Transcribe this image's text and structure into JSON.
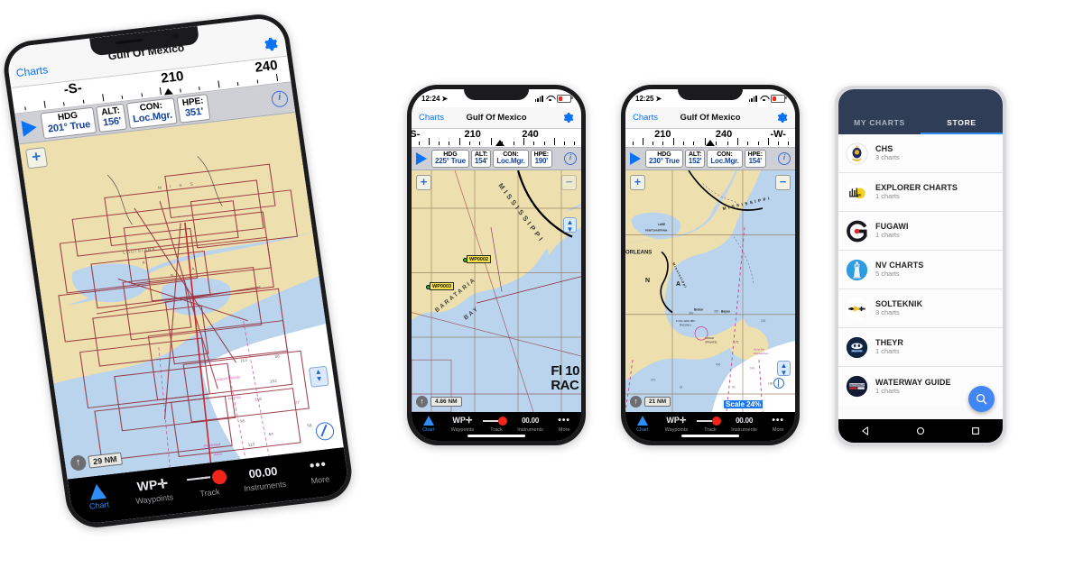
{
  "scene": {
    "background": "#ffffff",
    "accent_blue": "#0a72f5",
    "android_header": "#2f3e56",
    "android_accent": "#2f8ef5",
    "waypoint_yellow": "#fbe14a"
  },
  "phones": [
    {
      "id": "phone-main",
      "platform": "ios",
      "nav": {
        "back": "Charts",
        "title": "Gulf Of Mexico",
        "gear_icon": "gear-icon"
      },
      "compass": {
        "labels": [
          "-S-",
          "210",
          "240"
        ],
        "heading_marker": "heading-triangle"
      },
      "data": [
        {
          "key": "HDG",
          "value": "201° True"
        },
        {
          "key": "ALT:",
          "value": "156'"
        },
        {
          "key": "CON:",
          "value": "Loc.Mgr."
        },
        {
          "key": "HPE:",
          "value": "351'"
        }
      ],
      "map": {
        "zoom_in": "+",
        "zoom_out": "−",
        "scale": "29 NM",
        "north_icon": "north-arrow-icon",
        "style": "chart-catalog-boxes"
      },
      "tabs": [
        {
          "label": "Chart",
          "icon": "triangle-boat-icon",
          "active": true
        },
        {
          "label": "Waypoints",
          "icon": "waypoint-plus-icon",
          "active": false
        },
        {
          "label": "Track",
          "icon": "track-record-icon",
          "active": false
        },
        {
          "label": "Instruments",
          "icon": "instruments-icon",
          "value": "00.00",
          "active": false
        },
        {
          "label": "More",
          "icon": "more-dots-icon",
          "active": false
        }
      ]
    },
    {
      "id": "phone-waypoints",
      "platform": "ios",
      "status": {
        "time": "12:24",
        "location_icon": "location-arrow-icon",
        "signal_icon": "cellular-icon",
        "wifi_icon": "wifi-icon",
        "battery_icon": "battery-low-icon"
      },
      "nav": {
        "back": "Charts",
        "title": "Gulf Of Mexico",
        "gear_icon": "gear-icon"
      },
      "compass": {
        "labels": [
          "S-",
          "210",
          "240"
        ],
        "heading_marker": "heading-triangle"
      },
      "data": [
        {
          "key": "HDG",
          "value": "225° True"
        },
        {
          "key": "ALT:",
          "value": "154'"
        },
        {
          "key": "CON:",
          "value": "Loc.Mgr."
        },
        {
          "key": "HPE:",
          "value": "190'"
        }
      ],
      "map": {
        "zoom_in": "+",
        "zoom_out": "−",
        "scale": "4.86 NM",
        "north_icon": "north-arrow-icon",
        "waypoints": [
          "WP0002",
          "WP0003"
        ],
        "chart_text": [
          "BARATARIA BAY",
          "MISSISSIPPI"
        ],
        "racon_label": "Fl 10\nRAC"
      },
      "tabs": [
        {
          "label": "Chart",
          "icon": "triangle-boat-icon",
          "active": true
        },
        {
          "label": "Waypoints",
          "icon": "waypoint-plus-icon",
          "active": false
        },
        {
          "label": "Track",
          "icon": "track-record-icon",
          "active": false
        },
        {
          "label": "Instruments",
          "icon": "instruments-icon",
          "value": "00.00",
          "active": false
        },
        {
          "label": "More",
          "icon": "more-dots-icon",
          "active": false
        }
      ]
    },
    {
      "id": "phone-scale",
      "platform": "ios",
      "status": {
        "time": "12:25",
        "location_icon": "location-arrow-icon",
        "signal_icon": "cellular-icon",
        "wifi_icon": "wifi-icon",
        "battery_icon": "battery-low-icon"
      },
      "nav": {
        "back": "Charts",
        "title": "Gulf Of Mexico",
        "gear_icon": "gear-icon"
      },
      "compass": {
        "labels": [
          "210",
          "240",
          "-W-"
        ],
        "heading_marker": "heading-triangle"
      },
      "data": [
        {
          "key": "HDG",
          "value": "230° True"
        },
        {
          "key": "ALT:",
          "value": "152'"
        },
        {
          "key": "CON:",
          "value": "Loc.Mgr."
        },
        {
          "key": "HPE:",
          "value": "154'"
        }
      ],
      "map": {
        "zoom_in": "+",
        "zoom_out": "−",
        "scale": "21 NM",
        "scale_percent": "Scale 24%",
        "north_icon": "north-arrow-icon",
        "chart_text": [
          "LAKE PONTCHARTRAIN",
          "ORLEANS",
          "MISSISSIPPI",
          "N",
          "A",
          "RACON"
        ]
      },
      "tabs": [
        {
          "label": "Chart",
          "icon": "triangle-boat-icon",
          "active": true
        },
        {
          "label": "Waypoints",
          "icon": "waypoint-plus-icon",
          "active": false
        },
        {
          "label": "Track",
          "icon": "track-record-icon",
          "active": false
        },
        {
          "label": "Instruments",
          "icon": "instruments-icon",
          "value": "00.00",
          "active": false
        },
        {
          "label": "More",
          "icon": "more-dots-icon",
          "active": false
        }
      ]
    }
  ],
  "android": {
    "tabs": [
      {
        "label": "MY CHARTS",
        "active": false
      },
      {
        "label": "STORE",
        "active": true
      }
    ],
    "charts": [
      {
        "name": "CHS",
        "count": "3 charts",
        "logo": "chs-crest-icon"
      },
      {
        "name": "EXPLORER CHARTS",
        "count": "1 charts",
        "logo": "explorer-charts-icon"
      },
      {
        "name": "FUGAWI",
        "count": "1 charts",
        "logo": "fugawi-g-icon"
      },
      {
        "name": "NV CHARTS",
        "count": "5 charts",
        "logo": "nv-charts-lighthouse-icon"
      },
      {
        "name": "SOLTEKNIK",
        "count": "3 charts",
        "logo": "solteknik-icon"
      },
      {
        "name": "THEYR",
        "count": "1 charts",
        "logo": "theyr-icon"
      },
      {
        "name": "WATERWAY GUIDE",
        "count": "1 charts",
        "logo": "waterway-guide-icon"
      }
    ],
    "fab": {
      "icon": "search-icon"
    },
    "navbar": [
      {
        "icon": "back-triangle-icon"
      },
      {
        "icon": "home-circle-icon"
      },
      {
        "icon": "recents-square-icon"
      }
    ]
  }
}
